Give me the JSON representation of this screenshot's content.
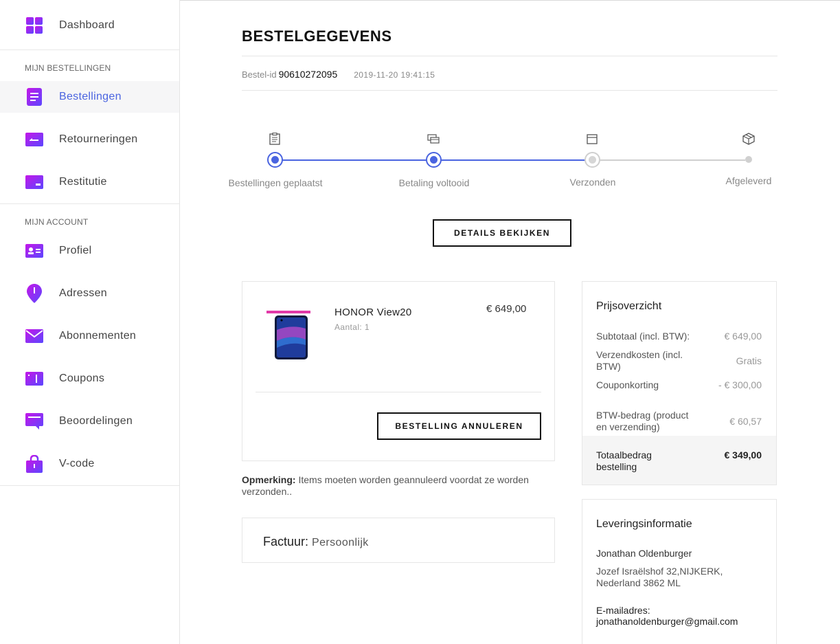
{
  "sidebar": {
    "dashboard": "Dashboard",
    "section_orders": "MIJN BESTELLINGEN",
    "section_account": "MIJN ACCOUNT",
    "items": [
      {
        "label": "Bestellingen",
        "icon": "orders-icon"
      },
      {
        "label": "Retourneringen",
        "icon": "returns-icon"
      },
      {
        "label": "Restitutie",
        "icon": "refund-icon"
      },
      {
        "label": "Profiel",
        "icon": "profile-card-icon"
      },
      {
        "label": "Adressen",
        "icon": "location-pin-icon"
      },
      {
        "label": "Abonnementen",
        "icon": "mail-icon"
      },
      {
        "label": "Coupons",
        "icon": "coupon-icon"
      },
      {
        "label": "Beoordelingen",
        "icon": "review-icon"
      },
      {
        "label": "V-code",
        "icon": "lock-bag-icon"
      }
    ],
    "active": "Bestellingen"
  },
  "order": {
    "title": "BESTELGEGEVENS",
    "id_label": "Bestel-id",
    "id": "90610272095",
    "datetime": "2019-11-20 19:41:15"
  },
  "progress": {
    "steps": [
      {
        "label": "Bestellingen geplaatst",
        "icon": "clipboard-icon",
        "done": true
      },
      {
        "label": "Betaling voltooid",
        "icon": "payment-card-icon",
        "done": true
      },
      {
        "label": "Verzonden",
        "icon": "box-icon",
        "done": false
      },
      {
        "label": "Afgeleverd",
        "icon": "package-icon",
        "done": false
      }
    ]
  },
  "buttons": {
    "details": "DETAILS BEKIJKEN",
    "cancel": "BESTELLING ANNULEREN"
  },
  "product": {
    "name": "HONOR View20",
    "qty": "Aantal: 1",
    "price": "€ 649,00"
  },
  "note": {
    "label": "Opmerking:",
    "text": "Items moeten worden geannuleerd voordat ze worden verzonden.."
  },
  "invoice": {
    "label": "Factuur:",
    "value": "Persoonlijk"
  },
  "price_overview": {
    "title": "Prijsoverzicht",
    "rows": [
      {
        "label": "Subtotaal (incl. BTW):",
        "value": "€ 649,00"
      },
      {
        "label": "Verzendkosten (incl. BTW)",
        "value": "Gratis"
      },
      {
        "label": "Couponkorting",
        "value": "- € 300,00"
      },
      {
        "label": "BTW-bedrag (product en verzending)",
        "value": "€ 60,57"
      }
    ],
    "total_label": "Totaalbedrag bestelling",
    "total_value": "€ 349,00"
  },
  "delivery": {
    "title": "Leveringsinformatie",
    "name": "Jonathan Oldenburger",
    "address": "Jozef Israëlshof 32,NIJKERK, Nederland 3862 ML",
    "email_label": "E-mailadres:",
    "email": "jonathanoldenburger@gmail.com"
  },
  "colors": {
    "accent_blue": "#4a64e0",
    "icon_gradient_start": "#a020f0",
    "icon_gradient_end": "#5a4bff"
  }
}
